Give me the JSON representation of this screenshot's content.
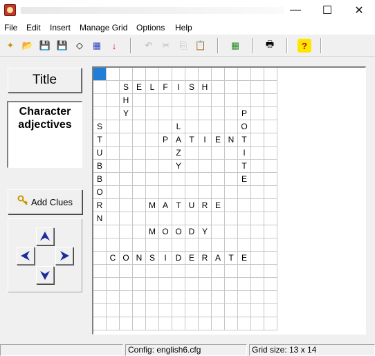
{
  "menu": [
    "File",
    "Edit",
    "Insert",
    "Manage Grid",
    "Options",
    "Help"
  ],
  "window_controls": {
    "minimize": "—",
    "maximize": "☐",
    "close": "✕"
  },
  "toolbar": {
    "buttons": [
      {
        "name": "new-icon",
        "glyph": "✦"
      },
      {
        "name": "open-icon",
        "glyph": "📂"
      },
      {
        "name": "save-icon",
        "glyph": "💾"
      },
      {
        "name": "save-all-icon",
        "glyph": "💾"
      },
      {
        "name": "eraser-icon",
        "glyph": "◇"
      },
      {
        "name": "scramble-icon",
        "glyph": "▦"
      },
      {
        "name": "down-arrow-icon",
        "glyph": "↓"
      },
      {
        "name": "undo-icon",
        "glyph": "↶"
      },
      {
        "name": "cut-icon",
        "glyph": "✂"
      },
      {
        "name": "copy-icon",
        "glyph": "⎘"
      },
      {
        "name": "paste-icon",
        "glyph": "📋"
      },
      {
        "name": "grid-icon",
        "glyph": "▦"
      },
      {
        "name": "print-icon",
        "glyph": "🖶"
      },
      {
        "name": "help-icon",
        "glyph": "?"
      }
    ]
  },
  "left_panel": {
    "title_button": "Title",
    "title_text_line1": "Character",
    "title_text_line2": "adjectives",
    "add_clues_button": "Add Clues"
  },
  "grid": {
    "rows": [
      "              ",
      "  SELFISH     ",
      "  H           ",
      "  Y        P  ",
      "S     L    O  ",
      "T    PATIENT  ",
      "U     Z    I  ",
      "B     Y    T  ",
      "B          E  ",
      "O             ",
      "R   MATURE    ",
      "N             ",
      "    MOODY     ",
      "              ",
      " CONSIDERATE  ",
      "              ",
      "              ",
      "              ",
      "              ",
      "              "
    ],
    "selected_cell": [
      0,
      0
    ]
  },
  "statusbar": {
    "config": "Config: english6.cfg",
    "grid_size": "Grid size: 13 x 14"
  }
}
